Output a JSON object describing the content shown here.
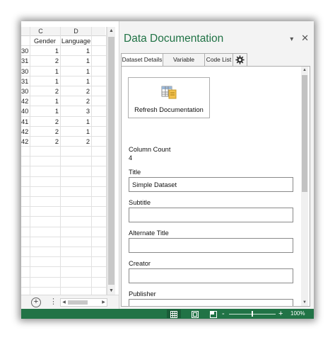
{
  "sheet": {
    "columns": [
      "C",
      "D"
    ],
    "header_row": {
      "b": "",
      "c": "Gender",
      "d": "Language"
    },
    "rows": [
      {
        "b": "30",
        "c": "1",
        "d": "1"
      },
      {
        "b": "31",
        "c": "2",
        "d": "1"
      },
      {
        "b": "30",
        "c": "1",
        "d": "1"
      },
      {
        "b": "31",
        "c": "1",
        "d": "1"
      },
      {
        "b": "30",
        "c": "2",
        "d": "2"
      },
      {
        "b": "42",
        "c": "1",
        "d": "2"
      },
      {
        "b": "40",
        "c": "1",
        "d": "3"
      },
      {
        "b": "41",
        "c": "2",
        "d": "1"
      },
      {
        "b": "42",
        "c": "2",
        "d": "1"
      },
      {
        "b": "42",
        "c": "2",
        "d": "2"
      },
      {
        "b": "",
        "c": "",
        "d": ""
      },
      {
        "b": "",
        "c": "",
        "d": ""
      },
      {
        "b": "",
        "c": "",
        "d": ""
      },
      {
        "b": "",
        "c": "",
        "d": ""
      },
      {
        "b": "",
        "c": "",
        "d": ""
      },
      {
        "b": "",
        "c": "",
        "d": ""
      },
      {
        "b": "",
        "c": "",
        "d": ""
      },
      {
        "b": "",
        "c": "",
        "d": ""
      },
      {
        "b": "",
        "c": "",
        "d": ""
      },
      {
        "b": "",
        "c": "",
        "d": ""
      },
      {
        "b": "",
        "c": "",
        "d": ""
      },
      {
        "b": "",
        "c": "",
        "d": ""
      },
      {
        "b": "",
        "c": "",
        "d": ""
      },
      {
        "b": "",
        "c": "",
        "d": ""
      }
    ],
    "add_sheet_label": "+",
    "more_label": "⋮"
  },
  "pane": {
    "title": "Data Documentation",
    "menu_glyph": "▾",
    "close_glyph": "✕",
    "tabs": [
      "Dataset Details",
      "Variable Details",
      "Code List"
    ],
    "refresh_label": "Refresh Documentation",
    "column_count_label": "Column Count",
    "column_count_value": "4",
    "fields": {
      "title_label": "Title",
      "title_value": "Simple Dataset",
      "subtitle_label": "Subtitle",
      "subtitle_value": "",
      "alternate_title_label": "Alternate Title",
      "alternate_title_value": "",
      "creator_label": "Creator",
      "creator_value": "",
      "publisher_label": "Publisher",
      "publisher_value": ""
    }
  },
  "status": {
    "zoom_minus": "-",
    "zoom_plus": "+",
    "zoom_level": 100,
    "zoom_label": "100%"
  },
  "colors": {
    "accent": "#217346"
  }
}
